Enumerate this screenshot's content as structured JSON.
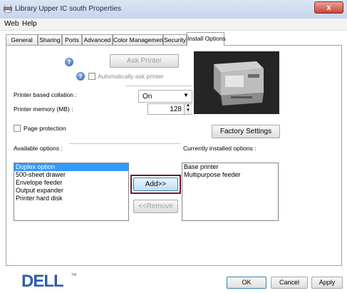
{
  "window": {
    "title": "Library Upper IC south Properties",
    "close_glyph": "x"
  },
  "menu": {
    "items": [
      "Web",
      "Help"
    ]
  },
  "tabs": [
    {
      "label": "General",
      "active": false
    },
    {
      "label": "Sharing",
      "active": false
    },
    {
      "label": "Ports",
      "active": false
    },
    {
      "label": "Advanced",
      "active": false
    },
    {
      "label": "Color Management",
      "active": false
    },
    {
      "label": "Security",
      "active": false
    },
    {
      "label": "Install Options",
      "active": true
    }
  ],
  "install": {
    "ask_printer_label": "Ask Printer",
    "auto_ask_label": "Automatically ask printer",
    "collation_label": "Printer based collation :",
    "collation_value": "On",
    "memory_label": "Printer memory (MB) :",
    "memory_value": "128",
    "page_protection_label": "Page protection",
    "factory_settings_label": "Factory Settings",
    "available_label": "Available options :",
    "installed_label": "Currently installed options :",
    "available_options": [
      "Duplex option",
      "500-sheet drawer",
      "Envelope feeder",
      "Output expander",
      "Printer hard disk"
    ],
    "selected_index": 0,
    "installed_options": [
      "Base printer",
      "Multipurpose feeder"
    ],
    "add_label": "Add>>",
    "remove_label": "<<Remove"
  },
  "footer": {
    "brand": "DELL",
    "tm": "TM",
    "ok_label": "OK",
    "cancel_label": "Cancel",
    "apply_label": "Apply"
  },
  "colors": {
    "accent": "#3399ff",
    "highlight_border": "#6b1a2e",
    "brand": "#2e5ea8"
  }
}
